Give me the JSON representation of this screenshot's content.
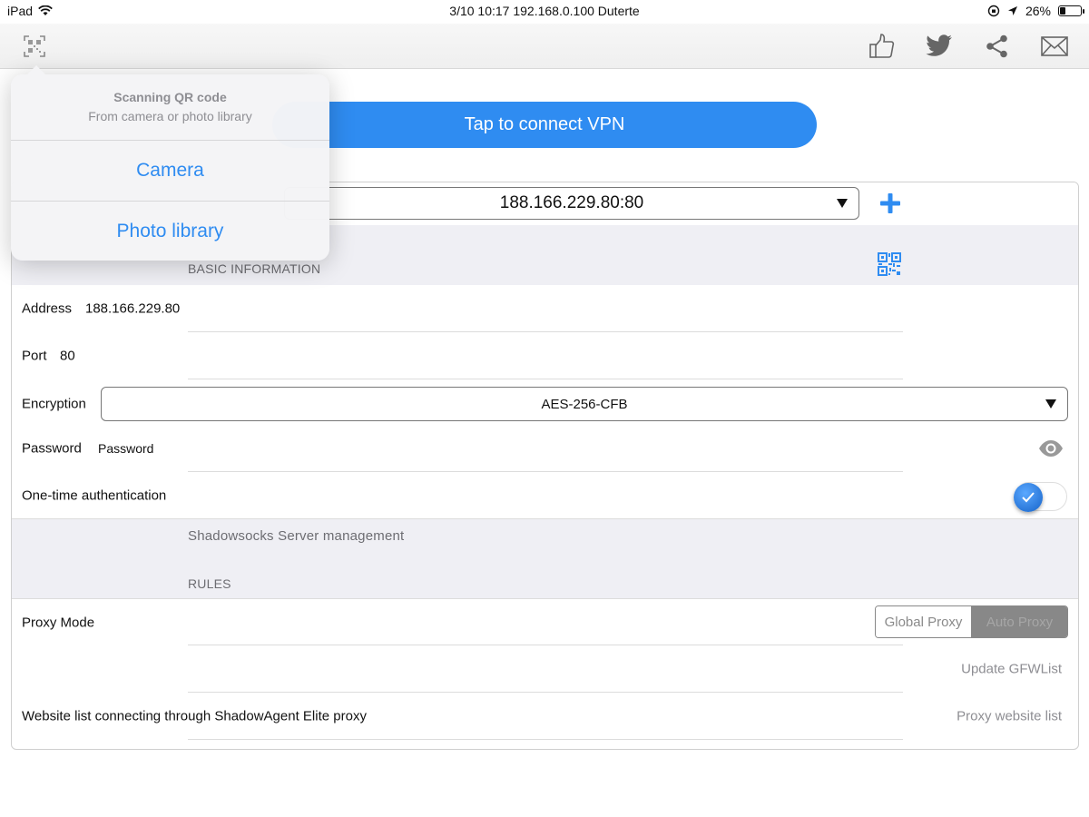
{
  "status_bar": {
    "device": "iPad",
    "center_text": "3/10 10:17 192.168.0.100 Duterte",
    "battery_level": 26,
    "battery_text": "26%"
  },
  "nav_bar": {
    "left_icon": "qr-scan-icon",
    "right_icons": [
      "thumbs-up-icon",
      "twitter-icon",
      "share-icon",
      "mail-icon"
    ]
  },
  "connect_button": {
    "label": "Tap to connect VPN"
  },
  "server": {
    "selected": "188.166.229.80:80"
  },
  "basic_information": {
    "header": "BASIC INFORMATION",
    "address_label": "Address",
    "address_value": "188.166.229.80",
    "port_label": "Port",
    "port_value": "80",
    "encryption_label": "Encryption",
    "encryption_value": "AES-256-CFB",
    "password_label": "Password",
    "password_placeholder": "Password",
    "ota_label": "One-time authentication",
    "ota_enabled": true
  },
  "management": {
    "label": "Shadowsocks Server management"
  },
  "rules": {
    "header": "RULES",
    "proxy_mode_label": "Proxy Mode",
    "proxy_mode_options": [
      "Global Proxy",
      "Auto Proxy"
    ],
    "proxy_mode_selected": "Auto Proxy",
    "update_gfwlist": "Update GFWList",
    "website_list_label": "Website list connecting through ShadowAgent Elite proxy",
    "proxy_website_list": "Proxy website list"
  },
  "popover": {
    "title": "Scanning QR code",
    "subtitle": "From camera or photo library",
    "options": [
      "Camera",
      "Photo library"
    ]
  },
  "colors": {
    "accent": "#2f8cf1",
    "section_background": "#efeff4",
    "secondary_text": "#8e8e93"
  }
}
